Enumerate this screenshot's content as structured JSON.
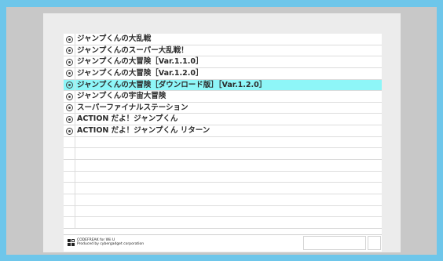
{
  "items": [
    {
      "label": "ジャンプくんの大乱戦",
      "selected": false
    },
    {
      "label": "ジャンプくんのスーパー大乱戦！",
      "selected": false
    },
    {
      "label": "ジャンプくんの大冒険［Var.1.1.0］",
      "selected": false
    },
    {
      "label": "ジャンプくんの大冒険［Var.1.2.0］",
      "selected": false
    },
    {
      "label": "ジャンプくんの大冒険［ダウンロード版］［Var.1.2.0］",
      "selected": true
    },
    {
      "label": "ジャンプくんの宇宙大冒険",
      "selected": false
    },
    {
      "label": "スーパーファイナルステーション",
      "selected": false
    },
    {
      "label": "ACTION だよ！ジャンプくん",
      "selected": false
    },
    {
      "label": "ACTION だよ！ジャンプくん リターン",
      "selected": false
    }
  ],
  "empty_rows": 8,
  "footer": {
    "line1": "CODEFREAK for Wii U",
    "line2": "Produced by cybergadget corporation"
  },
  "colors": {
    "background": "#6ec6ea",
    "selection": "#8ef6f8"
  }
}
